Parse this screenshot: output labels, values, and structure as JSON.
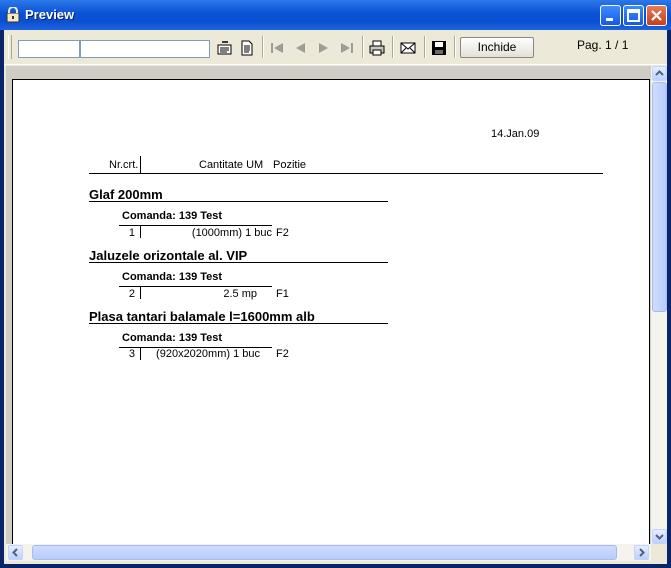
{
  "window": {
    "title": "Preview"
  },
  "toolbar": {
    "search_value": "",
    "page_value": "",
    "close_label": "Inchide",
    "page_indicator": "Pag. 1 / 1",
    "icons": [
      "find-icon",
      "find-next-icon",
      "first-page-icon",
      "prev-page-icon",
      "next-page-icon",
      "last-page-icon",
      "print-icon",
      "email-icon",
      "save-icon"
    ]
  },
  "report": {
    "date": "14.Jan.09",
    "header": {
      "nr": "Nr.crt.",
      "qty": "Cantitate UM",
      "pos": "Pozitie"
    },
    "groups": [
      {
        "title": "Glaf 200mm",
        "order": "Comanda: 139 Test",
        "row": {
          "nr": "1",
          "qty": "(1000mm) 1 buc",
          "pos": "F2"
        }
      },
      {
        "title": "Jaluzele orizontale al. VIP",
        "order": "Comanda: 139 Test",
        "row": {
          "nr": "2",
          "qty": "2.5 mp",
          "pos": "F1"
        }
      },
      {
        "title": "Plasa tantari balamale l=1600mm alb",
        "order": "Comanda: 139 Test",
        "row": {
          "nr": "3",
          "qty": "(920x2020mm) 1 buc",
          "pos": "F2"
        }
      }
    ]
  },
  "colors": {
    "titlebar": "#0a52d6",
    "frame": "#ece9d8",
    "paper": "#ffffff"
  }
}
